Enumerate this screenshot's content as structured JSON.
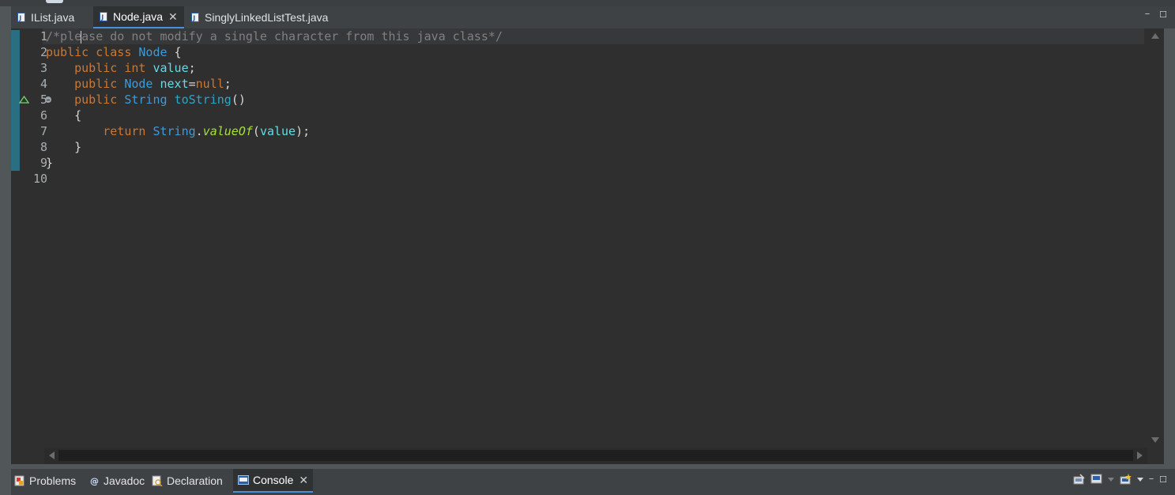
{
  "editor_tabs": [
    {
      "label": "IList.java",
      "active": false
    },
    {
      "label": "Node.java",
      "active": true,
      "closable": true
    },
    {
      "label": "SinglyLinkedListTest.java",
      "active": false
    }
  ],
  "line_numbers": [
    "1",
    "2",
    "3",
    "4",
    "5",
    "6",
    "7",
    "8",
    "9",
    "10"
  ],
  "code": {
    "l1_comment": "/*please do not modify a single character from this java class*/",
    "l2_kw1": "public",
    "l2_kw2": "class",
    "l2_name": "Node",
    "l2_rest": " {",
    "l3_kw1": "public",
    "l3_kw2": "int",
    "l3_field": "value",
    "l3_rest": ";",
    "l4_kw1": "public",
    "l4_type": "Node",
    "l4_field": "next",
    "l4_eq": "=",
    "l4_null": "null",
    "l4_rest": ";",
    "l5_kw1": "public",
    "l5_type": "String",
    "l5_method": "toString",
    "l5_rest": "()",
    "l6": "{",
    "l7_kw": "return",
    "l7_type": "String",
    "l7_dot": ".",
    "l7_method": "valueOf",
    "l7_open": "(",
    "l7_arg": "value",
    "l7_close": ");",
    "l8": "}",
    "l9": "}"
  },
  "bottom_tabs": [
    {
      "label": "Problems",
      "icon": "problems-icon"
    },
    {
      "label": "Javadoc",
      "icon": "javadoc-icon"
    },
    {
      "label": "Declaration",
      "icon": "declaration-icon"
    },
    {
      "label": "Console",
      "icon": "console-icon",
      "active": true,
      "closable": true
    }
  ],
  "icons": {
    "minimize": "−",
    "maximize": "☐",
    "close": "✕"
  },
  "colors": {
    "keyword": "#cc7832",
    "type": "#3f9ad6",
    "field": "#66d9e8",
    "comment": "#808080",
    "static_method": "#a6e22e",
    "accent": "#4a90d9"
  }
}
